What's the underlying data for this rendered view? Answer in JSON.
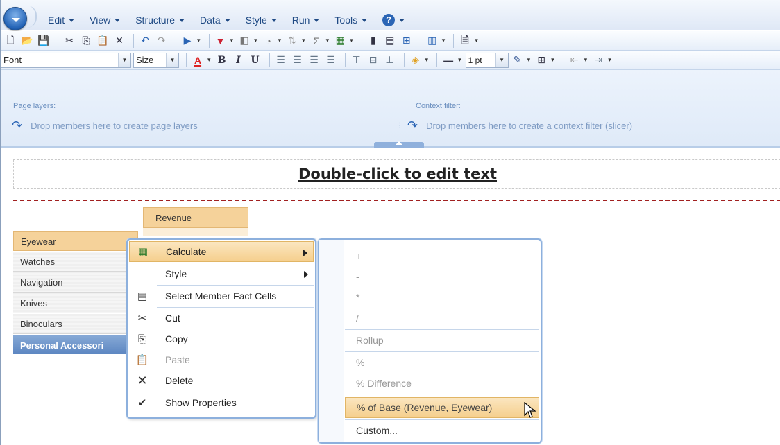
{
  "menubar": {
    "items": [
      {
        "label": "Edit"
      },
      {
        "label": "View"
      },
      {
        "label": "Structure"
      },
      {
        "label": "Data"
      },
      {
        "label": "Style"
      },
      {
        "label": "Run"
      },
      {
        "label": "Tools"
      }
    ],
    "help": "?"
  },
  "toolbar_format": {
    "font_value": "Font",
    "size_value": "Size",
    "line_width_value": "1 pt"
  },
  "layers": {
    "page_layers_label": "Page layers:",
    "page_layers_drop": "Drop members here to create page layers",
    "context_filter_label": "Context filter:",
    "context_filter_drop": "Drop members here to create a context filter (slicer)"
  },
  "report": {
    "title": "Double-click to edit text",
    "column_header": "Revenue",
    "rows": [
      "Eyewear",
      "Watches",
      "Navigation",
      "Knives",
      "Binoculars"
    ],
    "total_row": "Personal Accessori"
  },
  "context_menu": {
    "items": [
      {
        "label": "Calculate",
        "icon": "calculate-icon",
        "submenu": true,
        "selected": true
      },
      {
        "label": "Style",
        "icon": "",
        "submenu": true
      },
      {
        "label": "Select Member Fact Cells",
        "icon": "select-cells-icon"
      },
      {
        "label": "Cut",
        "icon": "cut-icon"
      },
      {
        "label": "Copy",
        "icon": "copy-icon"
      },
      {
        "label": "Paste",
        "icon": "paste-icon",
        "disabled": true
      },
      {
        "label": "Delete",
        "icon": "delete-icon"
      },
      {
        "label": "Show Properties",
        "icon": "check-icon"
      }
    ]
  },
  "calculate_submenu": {
    "items": [
      {
        "label": "+"
      },
      {
        "label": "-"
      },
      {
        "label": "*"
      },
      {
        "label": "/"
      },
      {
        "label": "Rollup"
      },
      {
        "label": "%"
      },
      {
        "label": "% Difference"
      },
      {
        "label": "% of Base (Revenue, Eyewear)",
        "selected": true
      },
      {
        "label": "Custom..."
      }
    ]
  },
  "colors": {
    "accent": "#2b65b5",
    "highlight": "#f5cf8d",
    "row_header": "#f5d29a",
    "total_row": "#5c86c1",
    "separator_dashes": "#a12020"
  }
}
